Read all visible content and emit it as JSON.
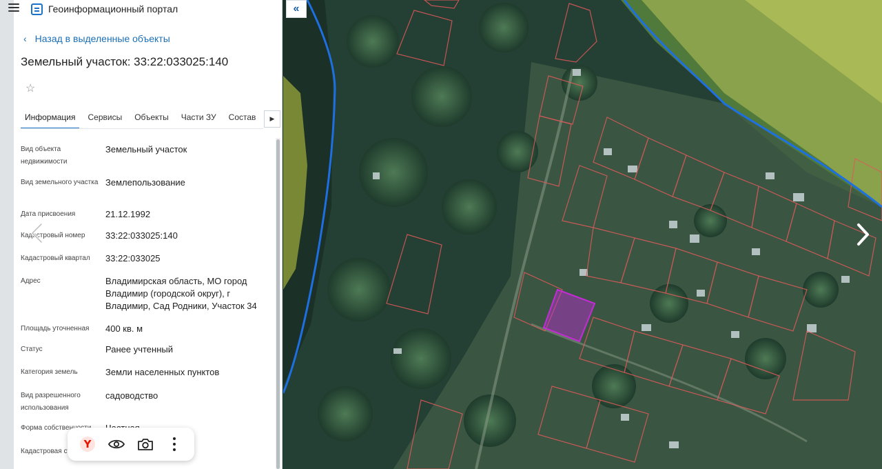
{
  "header": {
    "title": "Геоинформационный портал"
  },
  "nav": {
    "back_label": "Назад в выделенные объекты"
  },
  "object": {
    "title": "Земельный участок: 33:22:033025:140"
  },
  "tabs": [
    {
      "label": "Информация",
      "active": true
    },
    {
      "label": "Сервисы"
    },
    {
      "label": "Объекты"
    },
    {
      "label": "Части ЗУ"
    },
    {
      "label": "Состав"
    }
  ],
  "properties": [
    {
      "label": "Вид объекта недвижимости",
      "value": "Земельный участок"
    },
    {
      "label": "Вид земельного участка",
      "value": "Землепользование"
    },
    {
      "label": "Дата присвоения",
      "value": "21.12.1992"
    },
    {
      "label": "Кадастровый номер",
      "value": "33:22:033025:140"
    },
    {
      "label": "Кадастровый квартал",
      "value": "33:22:033025"
    },
    {
      "label": "Адрес",
      "value": "Владимирская область, МО город Владимир (городской округ), г Владимир, Сад Родники, Участок 34"
    },
    {
      "label": "Площадь уточненная",
      "value": "400 кв. м"
    },
    {
      "label": "Статус",
      "value": "Ранее учтенный"
    },
    {
      "label": "Категория земель",
      "value": "Земли населенных пунктов"
    },
    {
      "label": "Вид разрешенного использования",
      "value": "садоводство"
    },
    {
      "label": "Форма собственности",
      "value": "Частная"
    },
    {
      "label": "Кадастровая стоимость",
      "value": ""
    }
  ],
  "toolbar": {
    "icons": [
      "yandex-logo-icon",
      "eye-icon",
      "camera-icon",
      "more-vertical-icon"
    ],
    "yandex_letter": "Y"
  },
  "map": {
    "collapse_icon": "double-chevron-left-icon",
    "colors": {
      "boundary_line": "#1e6fe0",
      "parcel_outline": "#e05a5a",
      "selected_parcel": "#c42bd6",
      "field_overlay": "#d6e04a"
    }
  },
  "colors": {
    "accent": "#1a73c8",
    "link": "#1a6fb6"
  }
}
